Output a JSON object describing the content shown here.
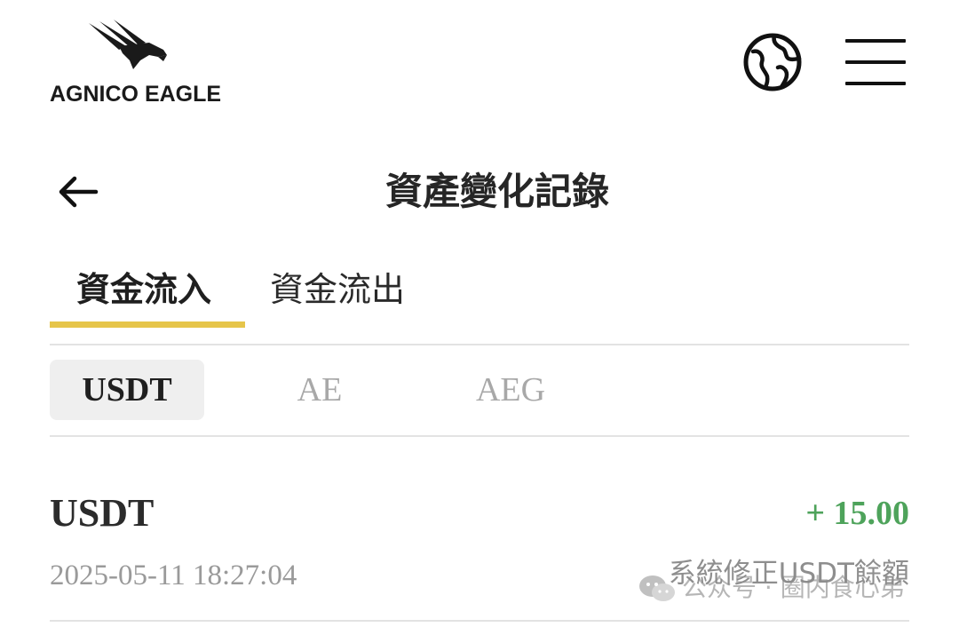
{
  "header": {
    "logo_text": "AGNICO EAGLE",
    "globe_icon": "globe-icon",
    "menu_icon": "hamburger-menu-icon"
  },
  "titlebar": {
    "back_icon": "arrow-left-icon",
    "title": "資產變化記錄"
  },
  "tabs": [
    {
      "label": "資金流入",
      "active": true
    },
    {
      "label": "資金流出",
      "active": false
    }
  ],
  "currency_filter": [
    {
      "label": "USDT",
      "selected": true
    },
    {
      "label": "AE",
      "selected": false
    },
    {
      "label": "AEG",
      "selected": false
    }
  ],
  "records": [
    {
      "currency": "USDT",
      "amount": "+ 15.00",
      "time": "2025-05-11 18:27:04",
      "note": "系統修正USDT餘額"
    }
  ],
  "watermark": {
    "text": "公众号 · 圈内食心弟",
    "icon": "wechat-icon"
  },
  "colors": {
    "accent_underline": "#e6c54a",
    "amount_positive": "#4ea35b",
    "chip_selected_bg": "#efefef",
    "muted_text": "#a8a8a8"
  }
}
